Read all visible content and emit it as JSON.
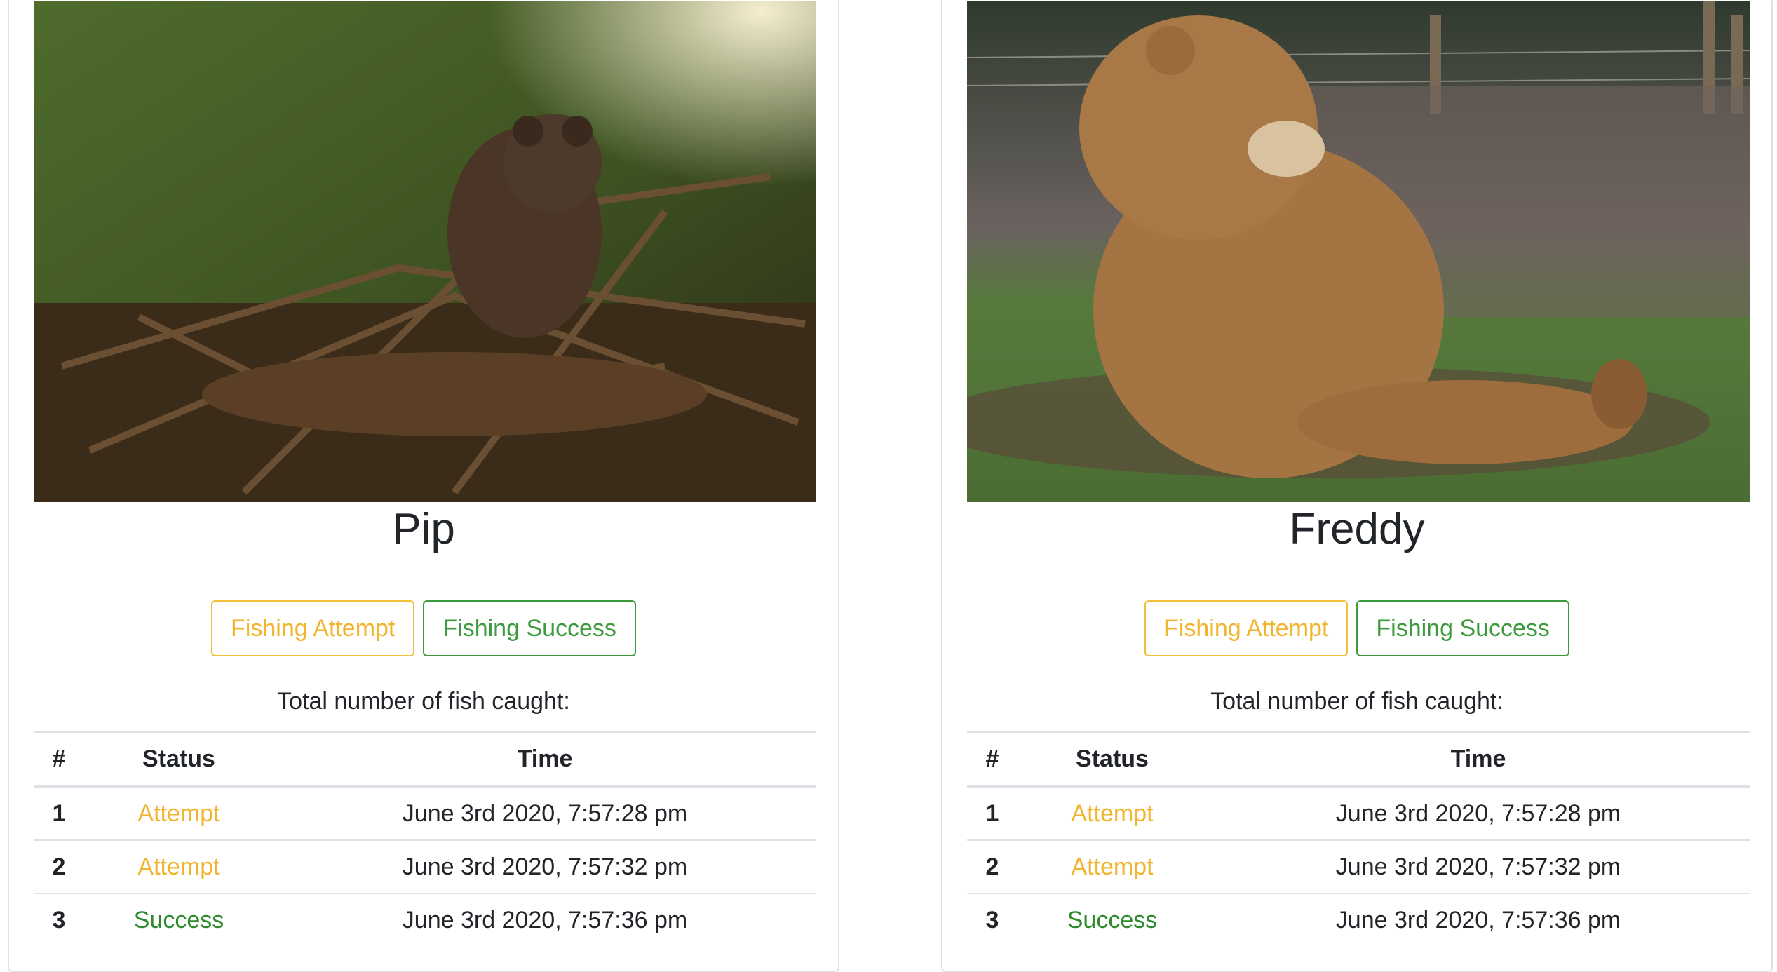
{
  "bears": [
    {
      "name": "Pip",
      "attempt_label": "Fishing Attempt",
      "success_label": "Fishing Success",
      "total_label": "Total number of fish caught:",
      "headers": {
        "num": "#",
        "status": "Status",
        "time": "Time"
      },
      "rows": [
        {
          "num": "1",
          "status": "Attempt",
          "time": "June 3rd 2020, 7:57:28 pm"
        },
        {
          "num": "2",
          "status": "Attempt",
          "time": "June 3rd 2020, 7:57:32 pm"
        },
        {
          "num": "3",
          "status": "Success",
          "time": "June 3rd 2020, 7:57:36 pm"
        }
      ]
    },
    {
      "name": "Freddy",
      "attempt_label": "Fishing Attempt",
      "success_label": "Fishing Success",
      "total_label": "Total number of fish caught:",
      "headers": {
        "num": "#",
        "status": "Status",
        "time": "Time"
      },
      "rows": [
        {
          "num": "1",
          "status": "Attempt",
          "time": "June 3rd 2020, 7:57:28 pm"
        },
        {
          "num": "2",
          "status": "Attempt",
          "time": "June 3rd 2020, 7:57:32 pm"
        },
        {
          "num": "3",
          "status": "Success",
          "time": "June 3rd 2020, 7:57:36 pm"
        }
      ]
    }
  ],
  "colors": {
    "attempt": "#f0b52c",
    "success": "#2d8a2d",
    "border": "#dee2e6"
  }
}
